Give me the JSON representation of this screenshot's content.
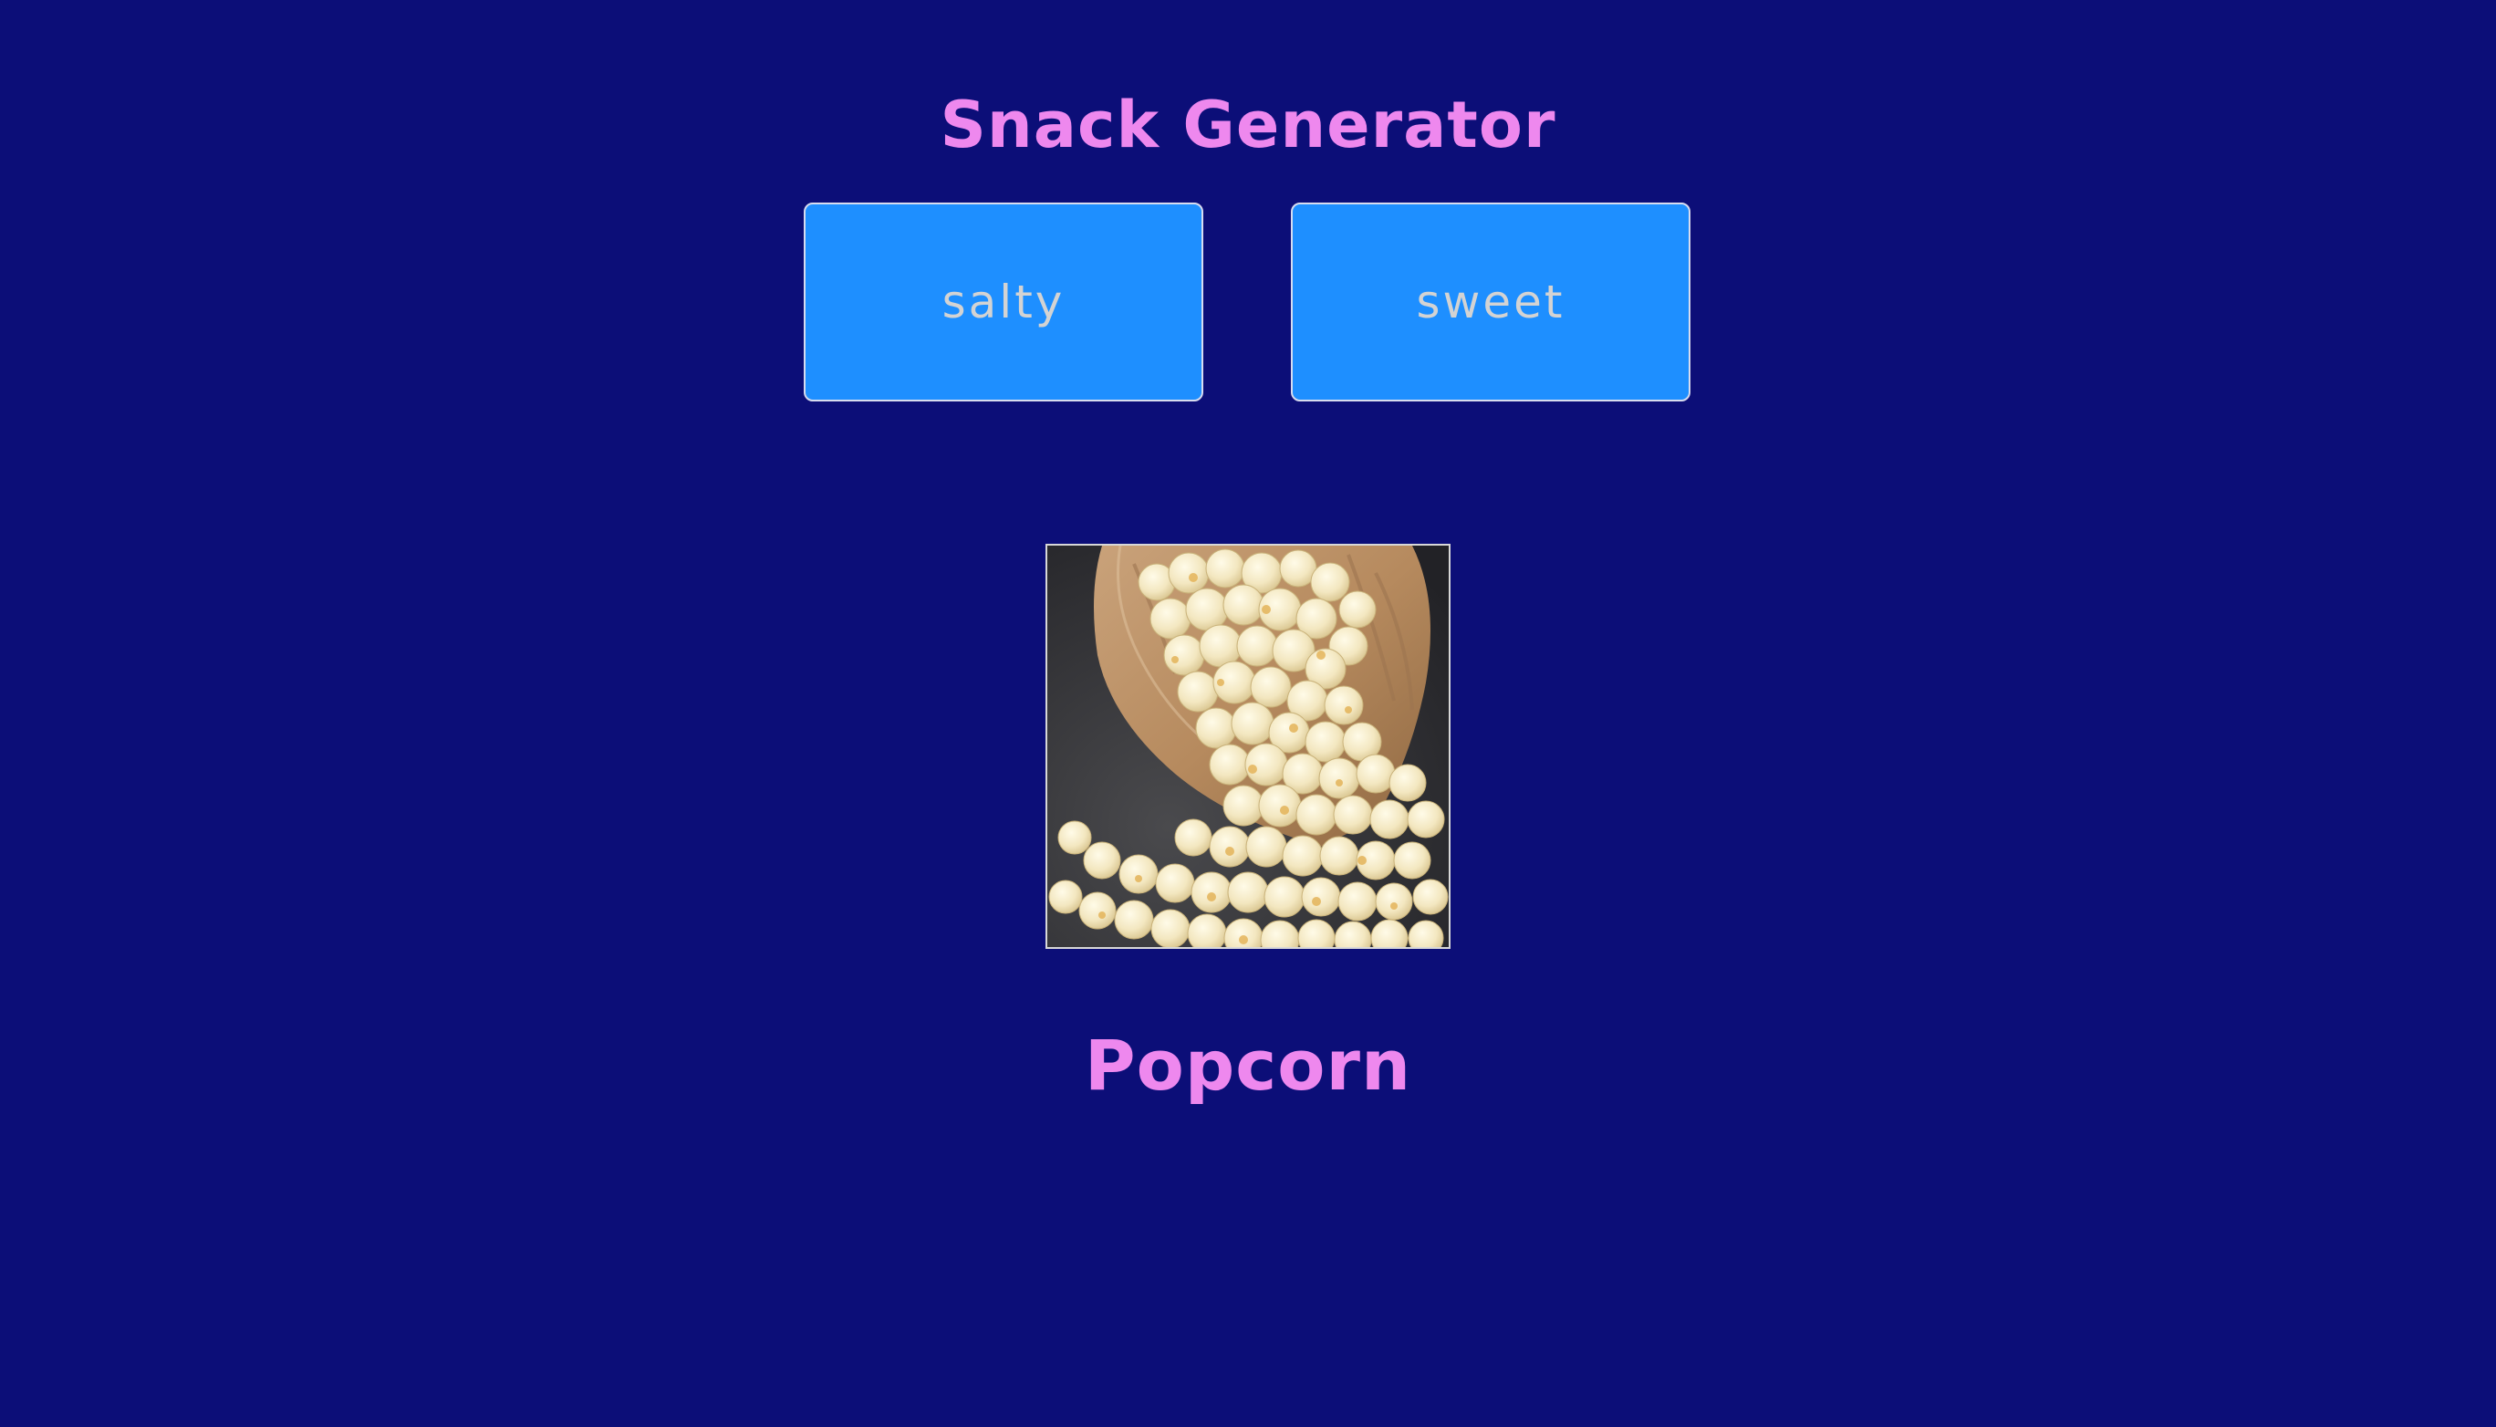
{
  "page": {
    "title": "Snack Generator",
    "background_color": "#0c0e78",
    "accent_color": "#ee88ee"
  },
  "buttons": {
    "salty_label": "salty",
    "sweet_label": "sweet",
    "button_color": "#1e8fff"
  },
  "result": {
    "image_subject": "popcorn-spilling-from-paper-bag",
    "snack_name": "Popcorn"
  }
}
